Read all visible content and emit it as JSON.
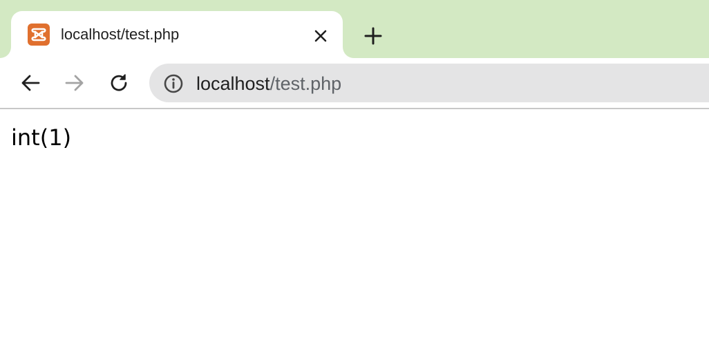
{
  "tab": {
    "title": "localhost/test.php",
    "favicon_icon": "xampp-icon",
    "close_icon": "close-icon"
  },
  "new_tab_icon": "plus-icon",
  "toolbar": {
    "back_icon": "arrow-left-icon",
    "forward_icon": "arrow-right-icon",
    "reload_icon": "reload-icon"
  },
  "omnibox": {
    "info_icon": "info-icon",
    "url_host": "localhost",
    "url_path": "/test.php"
  },
  "page": {
    "output": "int(1)"
  },
  "colors": {
    "tabstrip": "#d3e9c3",
    "omnibox": "#e4e4e5",
    "favicon": "#e0702e"
  }
}
